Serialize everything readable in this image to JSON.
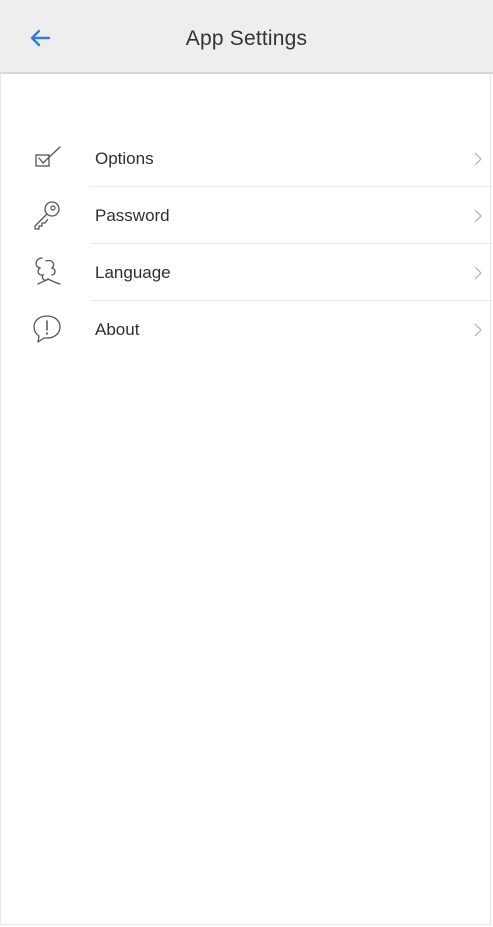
{
  "header": {
    "title": "App Settings",
    "back_icon": "arrow-left-icon",
    "accent_color": "#2f7fd8",
    "background": "#eeeeee"
  },
  "settings": {
    "items": [
      {
        "label": "Options",
        "icon": "checkbox-check-icon",
        "chevron": "chevron-right-icon"
      },
      {
        "label": "Password",
        "icon": "key-icon",
        "chevron": "chevron-right-icon"
      },
      {
        "label": "Language",
        "icon": "language-icon",
        "chevron": "chevron-right-icon"
      },
      {
        "label": "About",
        "icon": "info-bubble-icon",
        "chevron": "chevron-right-icon"
      }
    ]
  }
}
